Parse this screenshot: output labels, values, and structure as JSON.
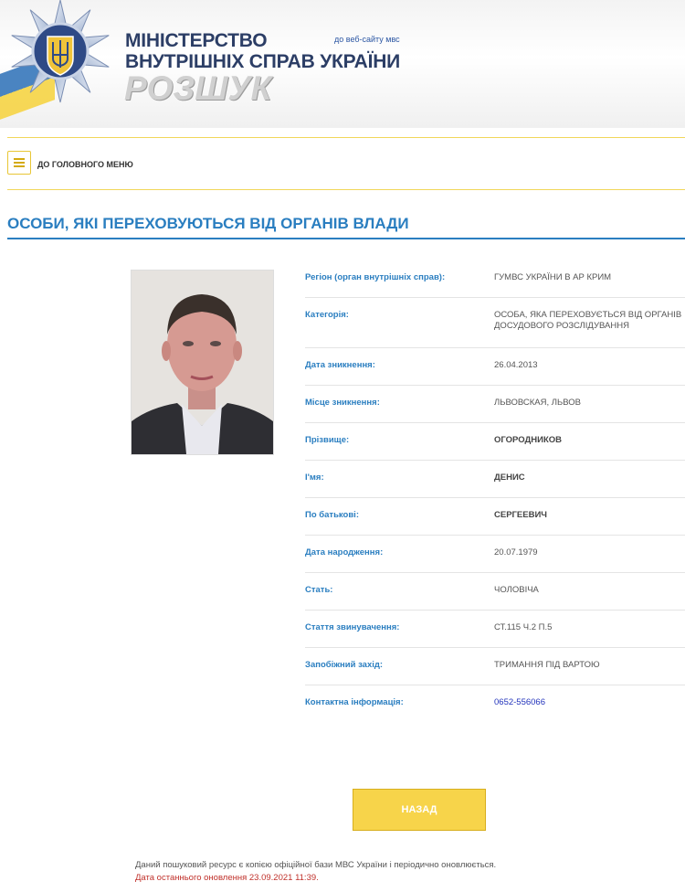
{
  "header": {
    "ministry_line1": "МІНІСТЕРСТВО",
    "ministry_line2": "ВНУТРІШНІХ СПРАВ УКРАЇНИ",
    "site_link": "до веб-сайту мвс",
    "search_title": "РОЗШУК"
  },
  "menu": {
    "home_label": "ДО ГОЛОВНОГО МЕНЮ",
    "icon": "list-icon"
  },
  "page": {
    "heading": "ОСОБИ, ЯКІ ПЕРЕХОВУЮТЬСЯ ВІД ОРГАНІВ ВЛАДИ"
  },
  "details": [
    {
      "label": "Регіон (орган внутрішніх справ):",
      "value": "ГУМВС УКРАЇНИ В АР КРИМ"
    },
    {
      "label": "Категорія:",
      "value": "ОСОБА, ЯКА ПЕРЕХОВУЄТЬСЯ ВІД ОРГАНІВ ДОСУДОВОГО РОЗСЛІДУВАННЯ"
    },
    {
      "label": "Дата зникнення:",
      "value": "26.04.2013"
    },
    {
      "label": "Місце зникнення:",
      "value": "ЛЬВОВСКАЯ, ЛЬВОВ"
    },
    {
      "label": "Прізвище:",
      "value": "ОГОРОДНИКОВ"
    },
    {
      "label": "І'мя:",
      "value": "ДЕНИС"
    },
    {
      "label": "По батькові:",
      "value": "СЕРГЕЕВИЧ"
    },
    {
      "label": "Дата народження:",
      "value": "20.07.1979"
    },
    {
      "label": "Стать:",
      "value": "ЧОЛОВІЧА"
    },
    {
      "label": "Стаття звинувачення:",
      "value": "СТ.115 Ч.2 П.5"
    },
    {
      "label": "Запобіжний захід:",
      "value": "ТРИМАННЯ ПІД ВАРТОЮ"
    },
    {
      "label": "Контактна інформація:",
      "value": "0652-556066"
    }
  ],
  "actions": {
    "back_label": "НАЗАД"
  },
  "footer": {
    "note": "Даний пошуковий ресурс є копією офіційної бази МВС України і періодично оновлюється.",
    "update": "Дата останнього оновлення 23.09.2021 11:39."
  },
  "colors": {
    "accent_blue": "#2a7ec0",
    "button_yellow": "#f7d44a",
    "update_red": "#c0312b"
  }
}
